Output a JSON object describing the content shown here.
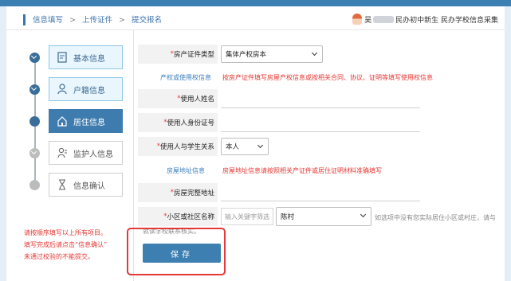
{
  "breadcrumb": [
    "信息填写",
    "上传证件",
    "提交报名"
  ],
  "breadcrumb_sep": ">",
  "user": {
    "prefix": "吴",
    "suffix": "民办初中新生 民办学校信息采集"
  },
  "steps": [
    {
      "label": "基本信息",
      "icon": "document-edit-icon",
      "state": "done"
    },
    {
      "label": "户籍信息",
      "icon": "person-icon",
      "state": "done"
    },
    {
      "label": "居住信息",
      "icon": "home-icon",
      "state": "active"
    },
    {
      "label": "监护人信息",
      "icon": "guardian-icon",
      "state": "pending"
    },
    {
      "label": "信息确认",
      "icon": "hourglass-icon",
      "state": "pending"
    }
  ],
  "notice": [
    "请按顺序填写以上所有项目。",
    "填写完成后请点击“信息确认”",
    "未通过校验的不能提交。"
  ],
  "form": {
    "property_type": {
      "label": "房产证件类型",
      "value": "集体产权房本"
    },
    "section1": {
      "title": "产权或使用权信息",
      "note": "按房产证件填写房屋产权信息或按相关合同、协议、证明等填写使用权信息"
    },
    "user_name": {
      "label": "使用人姓名"
    },
    "user_id": {
      "label": "使用人身份证号"
    },
    "relation": {
      "label": "使用人与学生关系",
      "value": "本人"
    },
    "section2": {
      "title": "房屋地址信息",
      "note": "房屋地址信息请按照相关产证件或居住证明材料准确填写"
    },
    "full_address": {
      "label": "房屋完整地址"
    },
    "community": {
      "label": "小区或社区名称",
      "placeholder": "输入关键字筛选",
      "value": "陈村",
      "hint": "如选项中没有您实际居住小区或村庄，请与",
      "hint2": "就读学校联系核实。"
    },
    "save_label": "保存"
  },
  "colors": {
    "accent": "#3e7fb2",
    "warning": "#e53935",
    "highlight": "#e53935"
  }
}
